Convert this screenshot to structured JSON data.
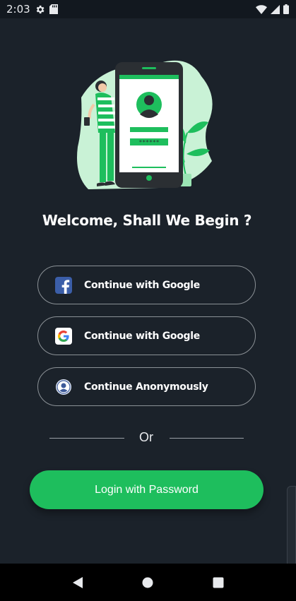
{
  "status_bar": {
    "time": "2:03",
    "left_icons": [
      "settings-icon",
      "sd-card-icon"
    ],
    "right_icons": [
      "wifi-icon",
      "signal-icon",
      "battery-icon"
    ]
  },
  "illustration": {
    "icon": "phone-login-illustration",
    "password_mask": "******"
  },
  "welcome": {
    "title": "Welcome, Shall We Begin ?"
  },
  "auth_buttons": [
    {
      "label": "Continue with Google",
      "icon": "facebook-icon"
    },
    {
      "label": "Continue with Google",
      "icon": "google-icon"
    },
    {
      "label": "Continue Anonymously",
      "icon": "anonymous-icon"
    }
  ],
  "divider": {
    "text": "Or"
  },
  "login": {
    "label": "Login with Password"
  },
  "colors": {
    "background": "#1b222a",
    "accent": "#1ebe5d",
    "button_border": "#8b9196"
  },
  "nav_bar": {
    "icons": [
      "back-icon",
      "home-icon",
      "recents-icon"
    ]
  }
}
